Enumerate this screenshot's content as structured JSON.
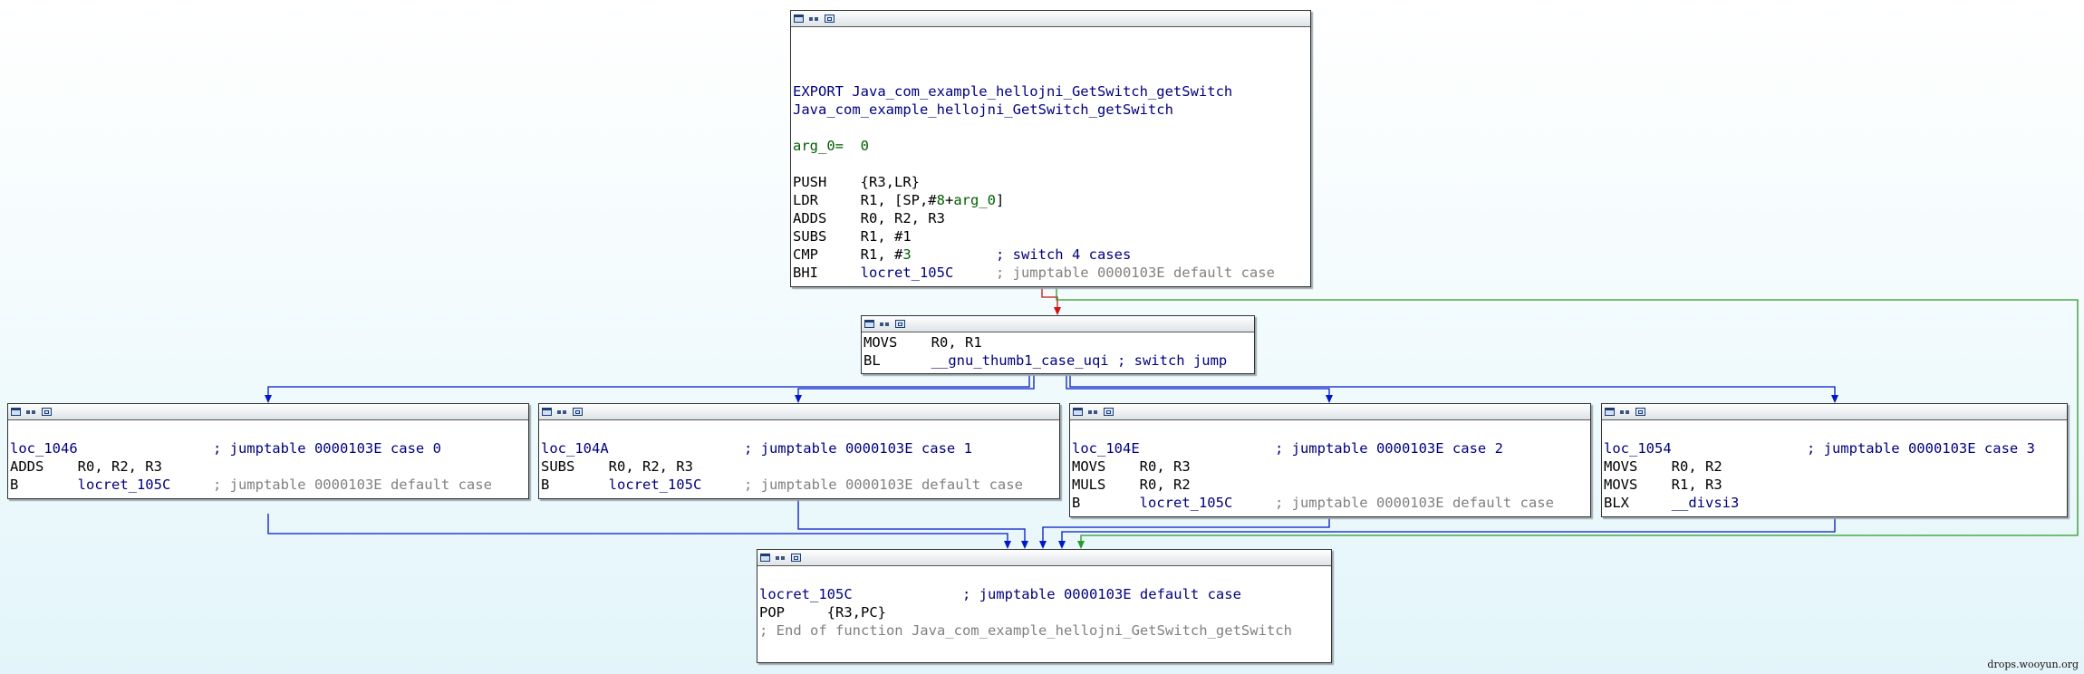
{
  "nodes": [
    {
      "id": "entry",
      "lines": [
        [],
        [],
        [],
        [
          {
            "t": "EXPORT Java_com_example_hellojni_GetSwitch_getSwitch",
            "c": "blue"
          }
        ],
        [
          {
            "t": "Java_com_example_hellojni_GetSwitch_getSwitch",
            "c": "blue"
          }
        ],
        [],
        [
          {
            "t": "arg_0=  ",
            "c": "green"
          },
          {
            "t": "0",
            "c": "green"
          }
        ],
        [],
        [
          {
            "t": "PUSH    {R3,LR}",
            "c": "black"
          }
        ],
        [
          {
            "t": "LDR     R1, [SP,#",
            "c": "black"
          },
          {
            "t": "8",
            "c": "green"
          },
          {
            "t": "+",
            "c": "black"
          },
          {
            "t": "arg_0",
            "c": "green"
          },
          {
            "t": "]",
            "c": "black"
          }
        ],
        [
          {
            "t": "ADDS    R0, R2, R3",
            "c": "black"
          }
        ],
        [
          {
            "t": "SUBS    R1, #1",
            "c": "black"
          }
        ],
        [
          {
            "t": "CMP     R1, #",
            "c": "black"
          },
          {
            "t": "3",
            "c": "green"
          },
          {
            "t": "          ; switch 4 cases",
            "c": "blue"
          }
        ],
        [
          {
            "t": "BHI     ",
            "c": "black"
          },
          {
            "t": "locret_105C",
            "c": "blue"
          },
          {
            "t": "     ; jumptable 0000103E default case",
            "c": "grey"
          }
        ]
      ]
    },
    {
      "id": "switch",
      "lines": [
        [
          {
            "t": "MOVS    R0, R1",
            "c": "black"
          }
        ],
        [
          {
            "t": "BL      ",
            "c": "black"
          },
          {
            "t": "__gnu_thumb1_case_uqi ; switch jump",
            "c": "blue"
          }
        ]
      ]
    },
    {
      "id": "case0",
      "lines": [
        [],
        [
          {
            "t": "loc_1046",
            "c": "blue"
          },
          {
            "t": "                ; jumptable 0000103E case 0",
            "c": "blue"
          }
        ],
        [
          {
            "t": "ADDS    R0, R2, R3",
            "c": "black"
          }
        ],
        [
          {
            "t": "B       ",
            "c": "black"
          },
          {
            "t": "locret_105C",
            "c": "blue"
          },
          {
            "t": "     ; jumptable 0000103E default case",
            "c": "grey"
          }
        ]
      ]
    },
    {
      "id": "case1",
      "lines": [
        [],
        [
          {
            "t": "loc_104A",
            "c": "blue"
          },
          {
            "t": "                ; jumptable 0000103E case 1",
            "c": "blue"
          }
        ],
        [
          {
            "t": "SUBS    R0, R2, R3",
            "c": "black"
          }
        ],
        [
          {
            "t": "B       ",
            "c": "black"
          },
          {
            "t": "locret_105C",
            "c": "blue"
          },
          {
            "t": "     ; jumptable 0000103E default case",
            "c": "grey"
          }
        ]
      ]
    },
    {
      "id": "case2",
      "lines": [
        [],
        [
          {
            "t": "loc_104E",
            "c": "blue"
          },
          {
            "t": "                ; jumptable 0000103E case 2",
            "c": "blue"
          }
        ],
        [
          {
            "t": "MOVS    R0, R3",
            "c": "black"
          }
        ],
        [
          {
            "t": "MULS    R0, R2",
            "c": "black"
          }
        ],
        [
          {
            "t": "B       ",
            "c": "black"
          },
          {
            "t": "locret_105C",
            "c": "blue"
          },
          {
            "t": "     ; jumptable 0000103E default case",
            "c": "grey"
          }
        ]
      ]
    },
    {
      "id": "case3",
      "lines": [
        [],
        [
          {
            "t": "loc_1054",
            "c": "blue"
          },
          {
            "t": "                ; jumptable 0000103E case 3",
            "c": "blue"
          }
        ],
        [
          {
            "t": "MOVS    R0, R2",
            "c": "black"
          }
        ],
        [
          {
            "t": "MOVS    R1, R3",
            "c": "black"
          }
        ],
        [
          {
            "t": "BLX     ",
            "c": "black"
          },
          {
            "t": "__divsi3",
            "c": "blue"
          }
        ]
      ]
    },
    {
      "id": "exit",
      "lines": [
        [],
        [
          {
            "t": "locret_105C",
            "c": "blue"
          },
          {
            "t": "             ; jumptable 0000103E default case",
            "c": "blue"
          }
        ],
        [
          {
            "t": "POP     {R3,PC}",
            "c": "black"
          }
        ],
        [
          {
            "t": "; End of function Java_com_example_hellojni_GetSwitch_getSwitch",
            "c": "grey"
          }
        ]
      ]
    }
  ],
  "edges": [
    {
      "from": "entry",
      "to": "switch",
      "color": "#d01010"
    },
    {
      "from": "entry",
      "to": "exit",
      "color": "#2a9a2a"
    },
    {
      "from": "switch",
      "to": "case0",
      "color": "#0018c8"
    },
    {
      "from": "switch",
      "to": "case1",
      "color": "#0018c8"
    },
    {
      "from": "switch",
      "to": "case2",
      "color": "#0018c8"
    },
    {
      "from": "switch",
      "to": "case3",
      "color": "#0018c8"
    },
    {
      "from": "case0",
      "to": "exit",
      "color": "#0018c8"
    },
    {
      "from": "case1",
      "to": "exit",
      "color": "#0018c8"
    },
    {
      "from": "case2",
      "to": "exit",
      "color": "#0018c8"
    },
    {
      "from": "case3",
      "to": "exit",
      "color": "#0018c8"
    }
  ],
  "watermark": "drops.wooyun.org"
}
